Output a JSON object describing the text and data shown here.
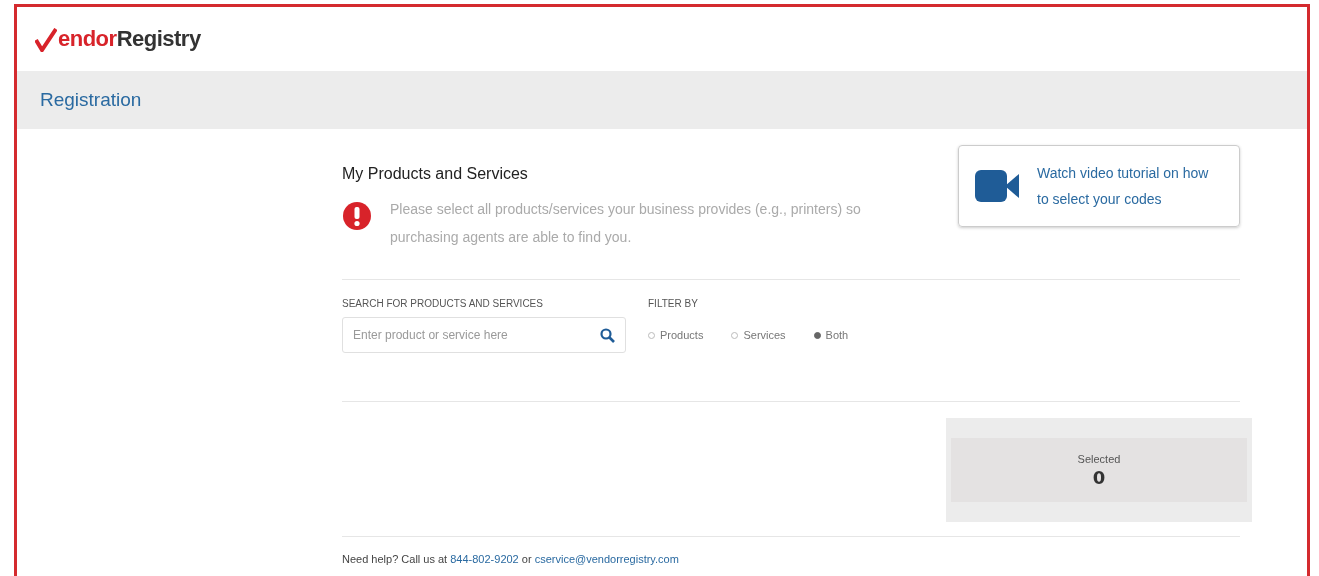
{
  "logo": {
    "part_red": "endor",
    "part_dark": "Registry"
  },
  "page_title": "Registration",
  "section": {
    "title": "My Products and Services",
    "notice": "Please select all products/services your business provides (e.g., printers) so purchasing agents are able to find you."
  },
  "video_link": {
    "text": "Watch video tutorial on how to select your codes"
  },
  "search": {
    "label": "SEARCH FOR PRODUCTS AND SERVICES",
    "placeholder": "Enter product or service here"
  },
  "filter": {
    "label": "FILTER BY",
    "options": [
      {
        "label": "Products",
        "selected": false
      },
      {
        "label": "Services",
        "selected": false
      },
      {
        "label": "Both",
        "selected": true
      }
    ]
  },
  "selected_panel": {
    "label": "Selected",
    "count": "0"
  },
  "help": {
    "text_before": "Need help? Call us at",
    "phone": "844-802-9202",
    "text_middle": "or",
    "email": "cservice@vendorregistry.com"
  }
}
